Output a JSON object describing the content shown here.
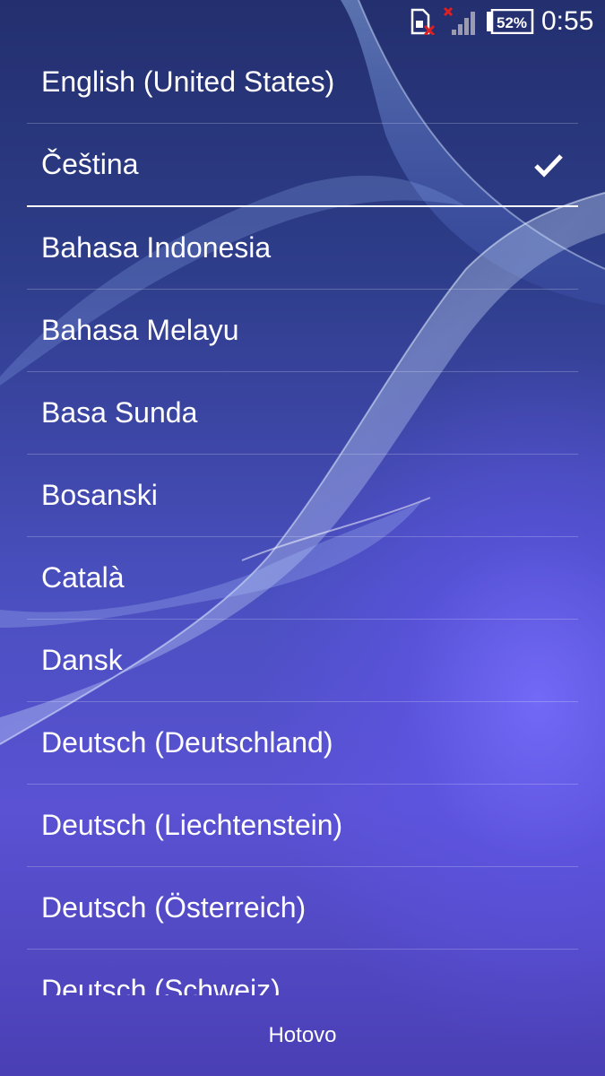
{
  "status_bar": {
    "sim_icon": "sim-card-missing-icon",
    "signal_icon": "signal-no-service-icon",
    "battery_icon": "battery-icon",
    "battery_percent": "52%",
    "time": "0:55"
  },
  "languages": [
    {
      "label": "English (United States)",
      "selected": false
    },
    {
      "label": "Čeština",
      "selected": true
    },
    {
      "label": "Bahasa Indonesia",
      "selected": false
    },
    {
      "label": "Bahasa Melayu",
      "selected": false
    },
    {
      "label": "Basa Sunda",
      "selected": false
    },
    {
      "label": "Bosanski",
      "selected": false
    },
    {
      "label": "Català",
      "selected": false
    },
    {
      "label": "Dansk",
      "selected": false
    },
    {
      "label": "Deutsch (Deutschland)",
      "selected": false
    },
    {
      "label": "Deutsch (Liechtenstein)",
      "selected": false
    },
    {
      "label": "Deutsch (Österreich)",
      "selected": false
    },
    {
      "label": "Deutsch (Schweiz)",
      "selected": false
    }
  ],
  "selected_icon": "checkmark-icon",
  "done_button": {
    "label": "Hotovo"
  }
}
